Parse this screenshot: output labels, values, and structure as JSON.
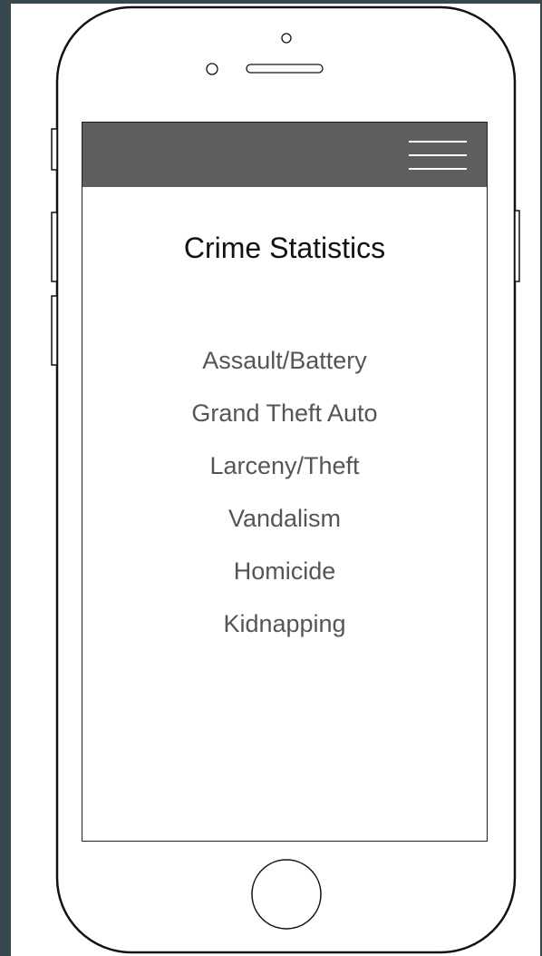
{
  "app": {
    "title": "Crime Statistics",
    "menu_icon": "hamburger-menu-icon"
  },
  "crime_types": [
    {
      "label": "Assault/Battery"
    },
    {
      "label": "Grand Theft Auto"
    },
    {
      "label": "Larceny/Theft"
    },
    {
      "label": "Vandalism"
    },
    {
      "label": "Homicide"
    },
    {
      "label": "Kidnapping"
    }
  ],
  "colors": {
    "header_bg": "#5e5e5e",
    "frame_bg": "#37474f",
    "title_text": "#111111",
    "list_text": "#555555"
  }
}
